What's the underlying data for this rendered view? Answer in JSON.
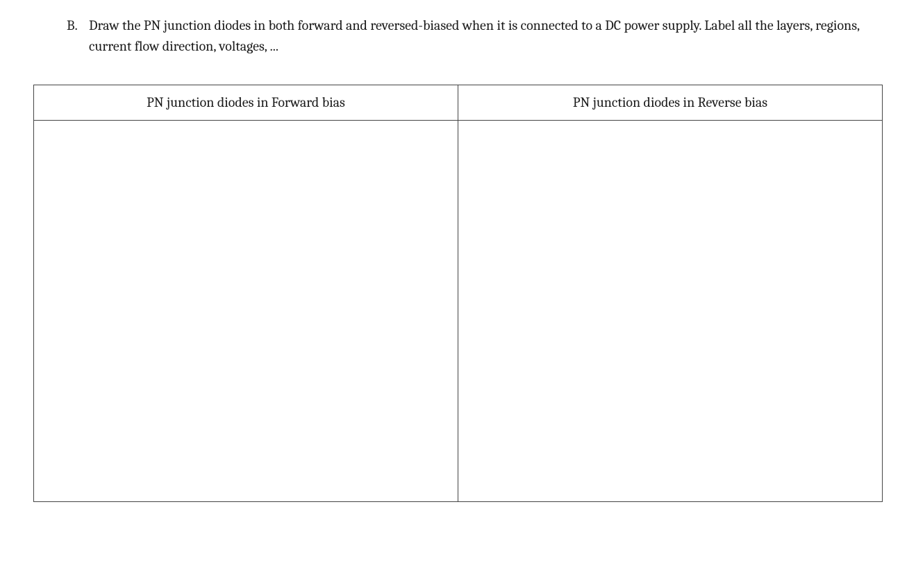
{
  "question": {
    "marker": "B.",
    "text": "Draw the PN junction diodes in both forward and reversed-biased when it is connected to a DC power supply. Label all the layers, regions, current flow direction, voltages, ..."
  },
  "table": {
    "headers": [
      "PN junction diodes in Forward bias",
      "PN junction diodes in Reverse bias"
    ]
  }
}
